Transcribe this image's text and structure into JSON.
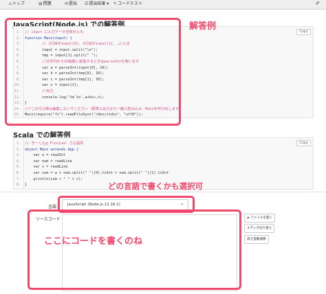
{
  "nav": {
    "items": [
      {
        "icon": "⌂",
        "label": "トップ"
      },
      {
        "icon": "▤",
        "label": "問題"
      },
      {
        "icon": "✉",
        "label": "提出"
      },
      {
        "icon": "☰",
        "label": "提出結果 ▾"
      },
      {
        "icon": "✎",
        "label": "コードテスト"
      }
    ],
    "pin_icon": "✐"
  },
  "js_section": {
    "title": "JavaScript(Node.js) での解答例",
    "copy_label": "Copy",
    "lines": [
      {
        "n": "1.",
        "text": "// input に入力データ全体が入る",
        "kind": "comment"
      },
      {
        "n": "2.",
        "text": "function Main(input) {",
        "kind": "keyword"
      },
      {
        "n": "3.",
        "text": "        // 1行目がinput[0], 2行目がinput[1], …に入る",
        "kind": "comment"
      },
      {
        "n": "4.",
        "text": "        input = input.split(\"\\n\");",
        "kind": "code"
      },
      {
        "n": "5.",
        "text": "        tmp = input[1].split(\" \");",
        "kind": "code"
      },
      {
        "n": "6.",
        "text": "        //文字列から10進数に変換するときはparseIntを使います",
        "kind": "comment"
      },
      {
        "n": "7.",
        "text": "        var a = parseInt(input[0], 10);",
        "kind": "code"
      },
      {
        "n": "8.",
        "text": "        var b = parseInt(tmp[0], 10);",
        "kind": "code"
      },
      {
        "n": "9.",
        "text": "        var c = parseInt(tmp[1], 10);",
        "kind": "code"
      },
      {
        "n": "10.",
        "text": "        var s = input[2];",
        "kind": "code"
      },
      {
        "n": "11.",
        "text": "        //出力",
        "kind": "comment"
      },
      {
        "n": "12.",
        "text": "        console.log('%d %s',a+b+c,s);",
        "kind": "code"
      },
      {
        "n": "13.",
        "text": "}",
        "kind": "code"
      },
      {
        "n": "14.",
        "text": "//*この行以降は編集しないでください（標準入出力から一度に読み込み、Mainを呼び出します）",
        "kind": "comment"
      },
      {
        "n": "15.",
        "text": "Main(require(\"fs\").readFileSync(\"/dev/stdin\", \"utf8\"));",
        "kind": "code"
      }
    ]
  },
  "scala_section": {
    "title": "Scala での解答例",
    "copy_label": "Copy",
    "lines": [
      {
        "n": "1.",
        "text": "// きーくん@_Floojual さん提供",
        "kind": "comment"
      },
      {
        "n": "2.",
        "text": "object Main extends App {",
        "kind": "keyword"
      },
      {
        "n": "3.",
        "text": "    var a = readInt",
        "kind": "code"
      },
      {
        "n": "4.",
        "text": "    var num = readLine",
        "kind": "code"
      },
      {
        "n": "5.",
        "text": "    var s = readLine",
        "kind": "code"
      },
      {
        "n": "6.",
        "text": "    var sum = a + num.split(\" \")(0).toInt + num.split(\" \")(1).toInt",
        "kind": "code"
      },
      {
        "n": "7.",
        "text": "    println(sum + \" \" + s);",
        "kind": "code"
      },
      {
        "n": "8.",
        "text": "}",
        "kind": "code"
      }
    ]
  },
  "submit": {
    "language_label": "言語",
    "language_value": "JavaScript (Node.js 12.16.1)",
    "source_label": "ソースコード",
    "buttons": {
      "open_file": "ファイルを開く",
      "toggle_editor": "エディタ切り替え",
      "auto_height": "高さ自動調節"
    }
  },
  "annotations": {
    "answer_example": "解答例",
    "any_language": "どの言語で書くかも選択可",
    "write_code_here": "ここにコードを書くのね"
  },
  "colors": {
    "annotation": "#ef4a6e",
    "comment": "#d44b84",
    "keyword": "#1f3aa6"
  }
}
